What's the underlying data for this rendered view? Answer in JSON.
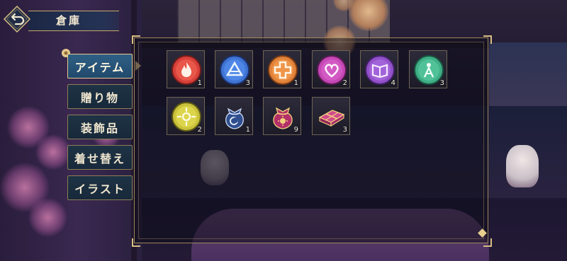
{
  "header": {
    "title": "倉庫",
    "back_icon": "back-arrow-icon"
  },
  "tabs": [
    {
      "label": "アイテム",
      "active": true
    },
    {
      "label": "贈り物",
      "active": false
    },
    {
      "label": "装飾品",
      "active": false
    },
    {
      "label": "着せ替え",
      "active": false
    },
    {
      "label": "イラスト",
      "active": false
    }
  ],
  "items": [
    {
      "icon": "fire-emblem-icon",
      "color": "#d8403a",
      "count": "1"
    },
    {
      "icon": "water-emblem-icon",
      "color": "#3f74d4",
      "count": "3"
    },
    {
      "icon": "cross-emblem-icon",
      "color": "#e0823a",
      "count": "1"
    },
    {
      "icon": "heart-emblem-icon",
      "color": "#c447b4",
      "count": "2"
    },
    {
      "icon": "book-emblem-icon",
      "color": "#9150c8",
      "count": "4"
    },
    {
      "icon": "spirit-emblem-icon",
      "color": "#3fae86",
      "count": "3"
    },
    {
      "icon": "sun-emblem-icon",
      "color": "#c9c23a",
      "count": "2"
    },
    {
      "icon": "blue-pouch-icon",
      "color": "#2f4f8e",
      "count": "1"
    },
    {
      "icon": "red-pouch-icon",
      "color": "#b33068",
      "count": "9"
    },
    {
      "icon": "gift-box-icon",
      "color": "#b13a78",
      "count": "3"
    }
  ]
}
